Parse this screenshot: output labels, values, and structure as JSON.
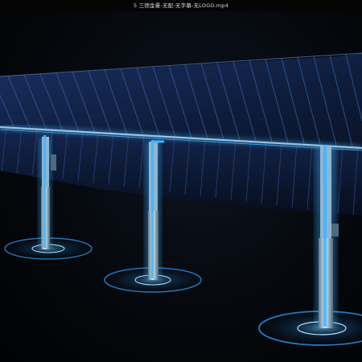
{
  "window": {
    "title": "5 三德金曼-无配-无字幕-无LOGO.mp4"
  },
  "scene": {
    "subject": "single-axis-solar-tracker",
    "colors": {
      "background": "#03060a",
      "panel": "#14254a",
      "panel_cell_line": "#2b4f88",
      "glow": "#3fb6ff",
      "pillar": "#9fbfd4"
    }
  }
}
